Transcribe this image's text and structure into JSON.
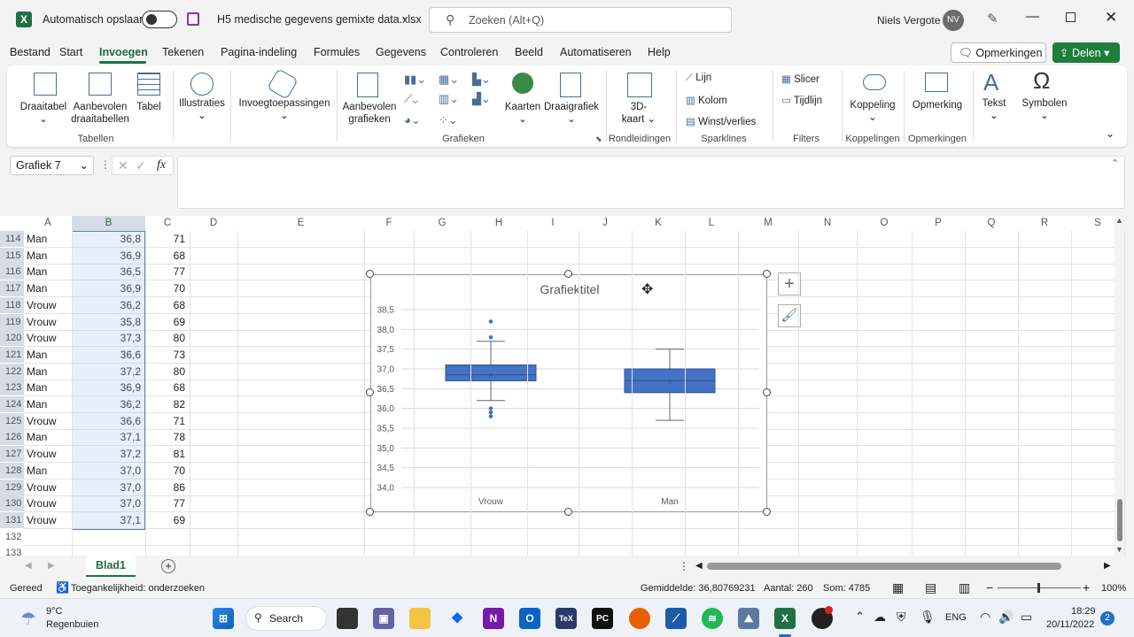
{
  "titlebar": {
    "autosave_label": "Automatisch opslaan",
    "filename": "H5 medische gegevens gemixte data.xlsx",
    "search_placeholder": "Zoeken (Alt+Q)",
    "user_name": "Niels Vergote",
    "user_initials": "NV"
  },
  "menu": {
    "items": [
      "Bestand",
      "Start",
      "Invoegen",
      "Tekenen",
      "Pagina-indeling",
      "Formules",
      "Gegevens",
      "Controleren",
      "Beeld",
      "Automatiseren",
      "Help"
    ],
    "active": "Invoegen",
    "comments_label": "Opmerkingen",
    "share_label": "Delen"
  },
  "ribbon": {
    "pivot": "Draaitabel",
    "rec_pivot_1": "Aanbevolen",
    "rec_pivot_2": "draaitabellen",
    "table": "Tabel",
    "group_tables": "Tabellen",
    "illustrations": "Illustraties",
    "addins": "Invoegtoepassingen",
    "rec_charts_1": "Aanbevolen",
    "rec_charts_2": "grafieken",
    "maps": "Kaarten",
    "pivotchart": "Draaigrafiek",
    "group_charts": "Grafieken",
    "map3d_1": "3D-",
    "map3d_2": "kaart",
    "group_tours": "Rondleidingen",
    "spark_line": "Lijn",
    "spark_column": "Kolom",
    "spark_winloss": "Winst/verlies",
    "group_sparklines": "Sparklines",
    "slicer": "Slicer",
    "timeline": "Tijdlijn",
    "group_filters": "Filters",
    "link": "Koppeling",
    "group_links": "Koppelingen",
    "comment": "Opmerking",
    "group_comments": "Opmerkingen",
    "text": "Tekst",
    "symbols": "Symbolen"
  },
  "formula": {
    "namebox": "Grafiek 7",
    "fx": "fx",
    "content": ""
  },
  "columns": [
    "A",
    "B",
    "C",
    "D",
    "E",
    "F",
    "G",
    "H",
    "I",
    "J",
    "K",
    "L",
    "M",
    "N",
    "O",
    "P",
    "Q",
    "R",
    "S"
  ],
  "rows": [
    {
      "n": "114",
      "a": "Man",
      "b": "36,8",
      "c": "71"
    },
    {
      "n": "115",
      "a": "Man",
      "b": "36,9",
      "c": "68"
    },
    {
      "n": "116",
      "a": "Man",
      "b": "36,5",
      "c": "77"
    },
    {
      "n": "117",
      "a": "Man",
      "b": "36,9",
      "c": "70"
    },
    {
      "n": "118",
      "a": "Vrouw",
      "b": "36,2",
      "c": "68"
    },
    {
      "n": "119",
      "a": "Vrouw",
      "b": "35,8",
      "c": "69"
    },
    {
      "n": "120",
      "a": "Vrouw",
      "b": "37,3",
      "c": "80"
    },
    {
      "n": "121",
      "a": "Man",
      "b": "36,6",
      "c": "73"
    },
    {
      "n": "122",
      "a": "Man",
      "b": "37,2",
      "c": "80"
    },
    {
      "n": "123",
      "a": "Man",
      "b": "36,9",
      "c": "68"
    },
    {
      "n": "124",
      "a": "Man",
      "b": "36,2",
      "c": "82"
    },
    {
      "n": "125",
      "a": "Vrouw",
      "b": "36,6",
      "c": "71"
    },
    {
      "n": "126",
      "a": "Man",
      "b": "37,1",
      "c": "78"
    },
    {
      "n": "127",
      "a": "Vrouw",
      "b": "37,2",
      "c": "81"
    },
    {
      "n": "128",
      "a": "Man",
      "b": "37,0",
      "c": "70"
    },
    {
      "n": "129",
      "a": "Vrouw",
      "b": "37,0",
      "c": "86"
    },
    {
      "n": "130",
      "a": "Vrouw",
      "b": "37,0",
      "c": "77"
    },
    {
      "n": "131",
      "a": "Vrouw",
      "b": "37,1",
      "c": "69"
    },
    {
      "n": "132",
      "a": "",
      "b": "",
      "c": ""
    },
    {
      "n": "133",
      "a": "",
      "b": "",
      "c": ""
    }
  ],
  "chart_data": {
    "type": "box",
    "title": "Grafiektitel",
    "categories": [
      "Vrouw",
      "Man"
    ],
    "ylim": [
      34.0,
      38.5
    ],
    "yticks": [
      "34,0",
      "34,5",
      "35,0",
      "35,5",
      "36,0",
      "36,5",
      "37,0",
      "37,5",
      "38,0",
      "38,5"
    ],
    "boxes": [
      {
        "name": "Vrouw",
        "min": 36.2,
        "q1": 36.7,
        "median": 36.85,
        "mean": 36.85,
        "q3": 37.1,
        "max": 37.7,
        "outliers": [
          38.2,
          37.8,
          36.0,
          35.9,
          35.8
        ]
      },
      {
        "name": "Man",
        "min": 35.7,
        "q1": 36.4,
        "median": 36.7,
        "mean": 36.7,
        "q3": 37.0,
        "max": 37.5,
        "outliers": []
      }
    ],
    "color": "#4472c4",
    "grid": true
  },
  "sheet": {
    "tab": "Blad1"
  },
  "status": {
    "ready": "Gereed",
    "accessibility": "Toegankelijkheid: onderzoeken",
    "average": "Gemiddelde: 36,80769231",
    "count": "Aantal: 260",
    "sum": "Som: 4785",
    "zoom": "100%"
  },
  "taskbar": {
    "temp": "9°C",
    "weather": "Regenbuien",
    "search": "Search",
    "lang": "ENG",
    "time": "18:29",
    "date": "20/11/2022",
    "notif": "2"
  },
  "colors": {
    "excel_green": "#217346",
    "share_green": "#1e7f3a",
    "chart_blue": "#4472c4",
    "selection": "#d9e6f5"
  }
}
